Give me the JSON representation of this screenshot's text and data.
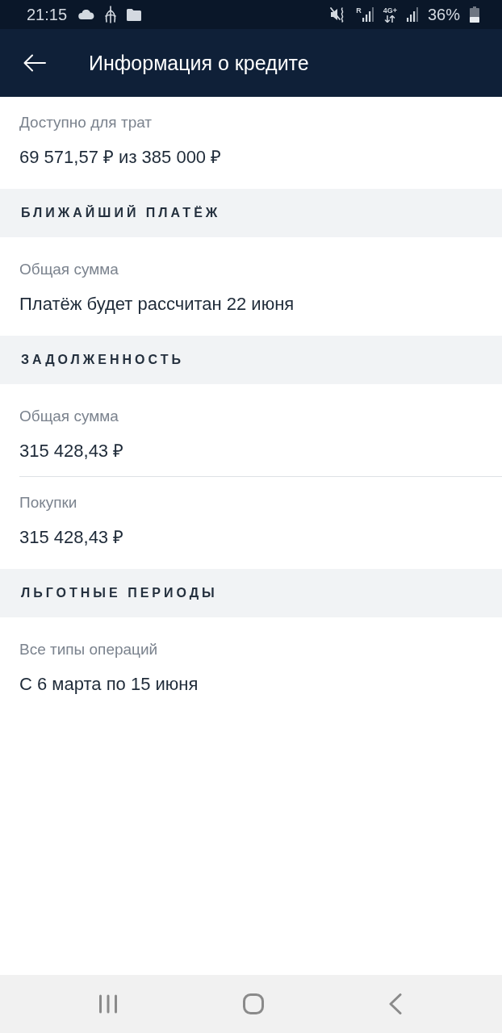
{
  "status_bar": {
    "time": "21:15",
    "roaming_mark": "R",
    "network_type": "4G+",
    "battery": "36%"
  },
  "app_bar": {
    "title": "Информация о кредите"
  },
  "groups": [
    {
      "items": [
        {
          "label": "Доступно для трат",
          "value": "69 571,57 ₽ из 385 000 ₽"
        }
      ]
    },
    {
      "header": "БЛИЖАЙШИЙ ПЛАТЁЖ",
      "items": [
        {
          "label": "Общая сумма",
          "value": "Платёж будет рассчитан 22 июня"
        }
      ]
    },
    {
      "header": "ЗАДОЛЖЕННОСТЬ",
      "items": [
        {
          "label": "Общая сумма",
          "value": "315 428,43 ₽"
        },
        {
          "label": "Покупки",
          "value": "315 428,43 ₽"
        }
      ]
    },
    {
      "header": "ЛЬГОТНЫЕ ПЕРИОДЫ",
      "items": [
        {
          "label": "Все типы операций",
          "value": "С 6 марта по 15 июня"
        }
      ]
    }
  ]
}
